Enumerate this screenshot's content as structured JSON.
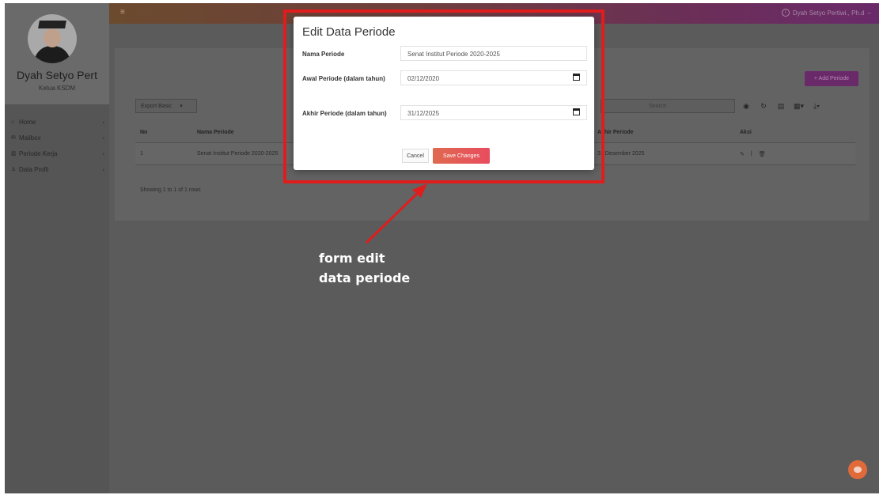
{
  "sidebar": {
    "user_name": "Dyah Setyo Pert",
    "user_role": "Ketua KSDM",
    "items": [
      {
        "icon": "home-icon",
        "label": "Home",
        "chevron": "‹"
      },
      {
        "icon": "mailbox-icon",
        "label": "Mailbox",
        "chevron": "‹"
      },
      {
        "icon": "chart-icon",
        "label": "Periode Kerja",
        "chevron": "‹"
      },
      {
        "icon": "user-icon",
        "label": "Data Profil",
        "chevron": "‹"
      }
    ]
  },
  "topbar": {
    "menu_glyph": "≡",
    "user_label": "Dyah Setyo Pertiwi., Ph.d"
  },
  "panel": {
    "add_button": "+ Add Periode",
    "export_label": "Export Basic",
    "search_placeholder": "Search",
    "table": {
      "headers": {
        "no": "No",
        "nama": "Nama Periode",
        "akhir": "Akhir Periode",
        "aksi": "Aksi"
      },
      "rows": [
        {
          "no": "1",
          "nama": "Senat Institut Periode 2020-2025",
          "akhir": "31 Desember 2025"
        }
      ]
    },
    "footer": "Showing 1 to 1 of 1 rows"
  },
  "modal": {
    "title": "Edit Data Periode",
    "fields": {
      "nama_label": "Nama Periode",
      "nama_value": "Senat Institut Periode 2020-2025",
      "awal_label": "Awal Periode (dalam tahun)",
      "awal_value": "02/12/2020",
      "akhir_label": "Akhir Periode (dalam tahun)",
      "akhir_value": "31/12/2025"
    },
    "cancel_label": "Cancel",
    "save_label": "Save Changes"
  },
  "annotation": {
    "line1": "form edit",
    "line2": "data periode"
  },
  "colors": {
    "highlight": "#e01d1d",
    "save_button": "#e84c5f",
    "add_button": "#6a2a6a"
  }
}
